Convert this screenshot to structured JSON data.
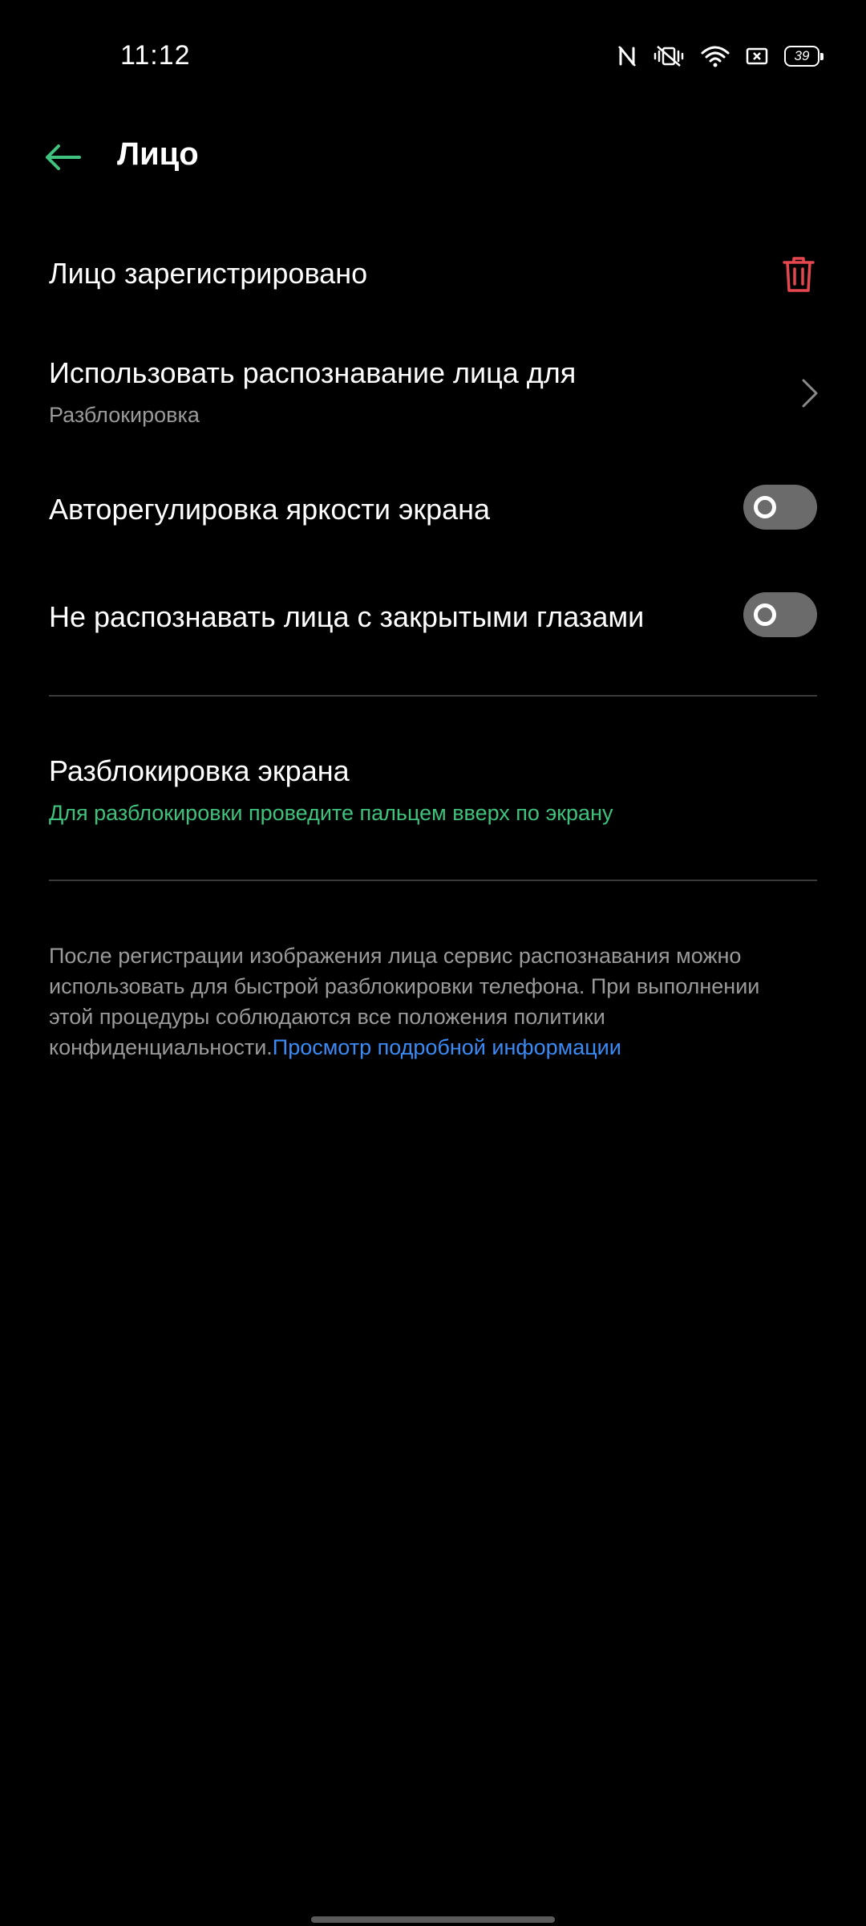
{
  "status_bar": {
    "time": "11:12",
    "battery": "39",
    "icons": [
      "nfc-icon",
      "vibrate-icon",
      "wifi-icon",
      "screen-cast-icon",
      "battery-icon"
    ]
  },
  "header": {
    "title": "Лицо",
    "back_icon": "back-arrow-icon"
  },
  "settings": {
    "face_registered": {
      "label": "Лицо зарегистрировано",
      "icon": "trash-icon"
    },
    "use_face_for": {
      "label": "Использовать распознавание лица для",
      "value": "Разблокировка",
      "icon": "chevron-right-icon"
    },
    "auto_brightness": {
      "label": "Авторегулировка яркости экрана",
      "enabled": false
    },
    "closed_eyes": {
      "label": "Не распознавать лица с закрытыми глазами",
      "enabled": false
    },
    "screen_unlock": {
      "label": "Разблокировка экрана",
      "value": "Для разблокировки проведите пальцем вверх по экрану"
    }
  },
  "footer": {
    "text": "После регистрации изображения лица сервис распознавания можно использовать для быстрой разблокировки телефона. При выполнении этой процедуры соблюдаются все положения политики конфиденциальности.",
    "link": "Просмотр подробной информации"
  },
  "colors": {
    "accent_green": "#3fc27d",
    "danger_red": "#e5474f",
    "link_blue": "#3a8bf6",
    "toggle_off": "#6b6b6b"
  }
}
